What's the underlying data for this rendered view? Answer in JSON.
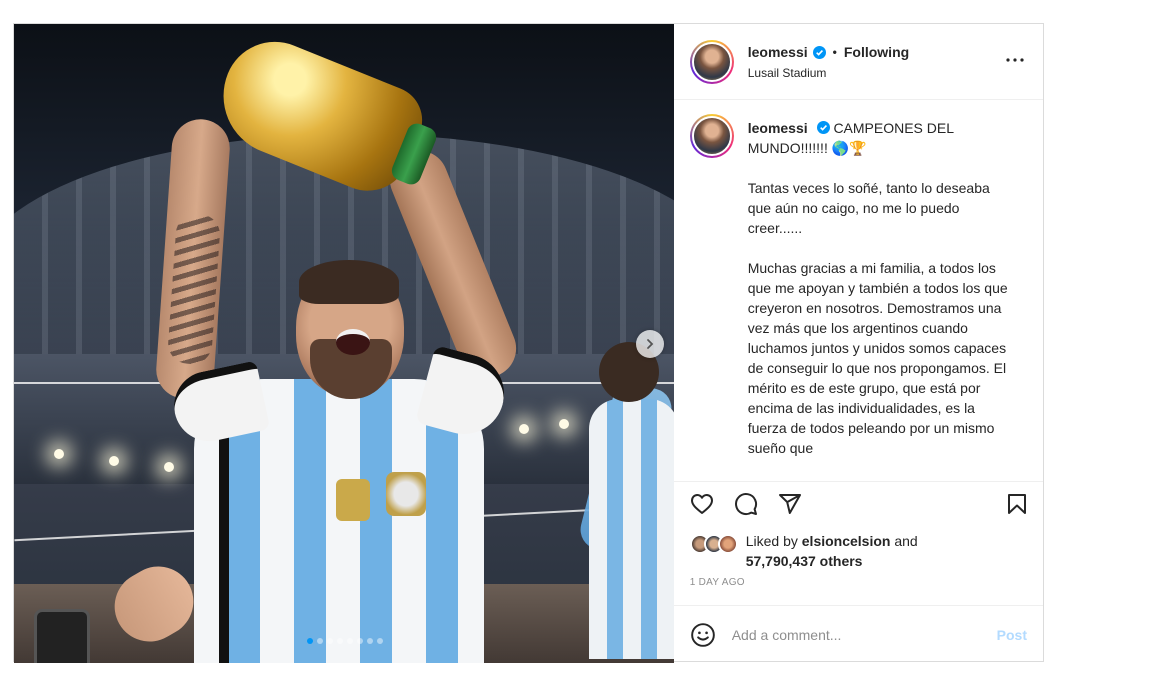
{
  "header": {
    "username": "leomessi",
    "separator": "•",
    "follow_status": "Following",
    "location": "Lusail Stadium",
    "verified_color": "#0095f6"
  },
  "caption": {
    "username": "leomessi",
    "first_line": "CAMPEONES DEL MUNDO!!!!!!! 🌎🏆",
    "paragraphs": [
      "Tantas veces lo soñé, tanto lo deseaba que aún no caigo, no me lo puedo creer......",
      "Muchas gracias a mi familia, a todos los que me apoyan y también a todos los que creyeron en nosotros. Demostramos una vez más que los argentinos cuando luchamos juntos y unidos somos capaces de conseguir lo que nos propongamos. El mérito es de este grupo, que está por encima de las individualidades, es la fuerza de todos peleando por un mismo sueño que"
    ]
  },
  "actions": {
    "like_icon": "heart-icon",
    "comment_icon": "comment-icon",
    "share_icon": "share-icon",
    "save_icon": "bookmark-icon"
  },
  "likes": {
    "prefix": "Liked by",
    "user": "elsioncelsion",
    "and": "and",
    "count": "57,790,437 others"
  },
  "timestamp": "1 DAY AGO",
  "comment": {
    "placeholder": "Add a comment...",
    "post_label": "Post",
    "post_color": "#b3dbff"
  },
  "carousel": {
    "total_slides": 8,
    "current_slide": 1,
    "accent": "#0095f6"
  }
}
